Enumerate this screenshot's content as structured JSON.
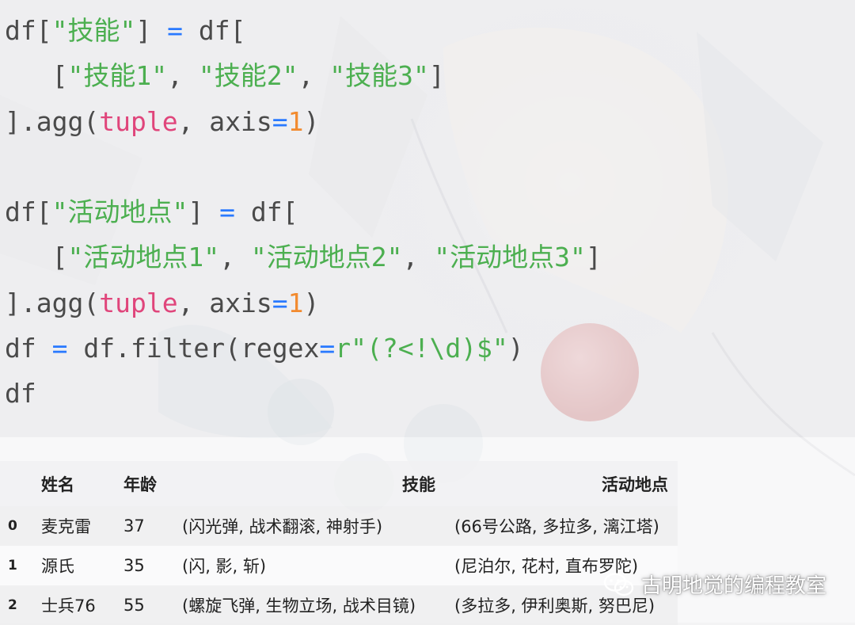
{
  "code": {
    "lines": [
      [
        {
          "t": "df[",
          "c": "plain"
        },
        {
          "t": "\"技能\"",
          "c": "str"
        },
        {
          "t": "] ",
          "c": "plain"
        },
        {
          "t": "=",
          "c": "op"
        },
        {
          "t": " df[",
          "c": "plain"
        }
      ],
      [
        {
          "t": "   [",
          "c": "plain"
        },
        {
          "t": "\"技能1\"",
          "c": "str"
        },
        {
          "t": ", ",
          "c": "plain"
        },
        {
          "t": "\"技能2\"",
          "c": "str"
        },
        {
          "t": ", ",
          "c": "plain"
        },
        {
          "t": "\"技能3\"",
          "c": "str"
        },
        {
          "t": "]",
          "c": "plain"
        }
      ],
      [
        {
          "t": "].agg(",
          "c": "plain"
        },
        {
          "t": "tuple",
          "c": "fn"
        },
        {
          "t": ", axis",
          "c": "plain"
        },
        {
          "t": "=",
          "c": "op"
        },
        {
          "t": "1",
          "c": "num"
        },
        {
          "t": ")",
          "c": "plain"
        }
      ],
      [],
      [
        {
          "t": "df[",
          "c": "plain"
        },
        {
          "t": "\"活动地点\"",
          "c": "str"
        },
        {
          "t": "] ",
          "c": "plain"
        },
        {
          "t": "=",
          "c": "op"
        },
        {
          "t": " df[",
          "c": "plain"
        }
      ],
      [
        {
          "t": "   [",
          "c": "plain"
        },
        {
          "t": "\"活动地点1\"",
          "c": "str"
        },
        {
          "t": ", ",
          "c": "plain"
        },
        {
          "t": "\"活动地点2\"",
          "c": "str"
        },
        {
          "t": ", ",
          "c": "plain"
        },
        {
          "t": "\"活动地点3\"",
          "c": "str"
        },
        {
          "t": "]",
          "c": "plain"
        }
      ],
      [
        {
          "t": "].agg(",
          "c": "plain"
        },
        {
          "t": "tuple",
          "c": "fn"
        },
        {
          "t": ", axis",
          "c": "plain"
        },
        {
          "t": "=",
          "c": "op"
        },
        {
          "t": "1",
          "c": "num"
        },
        {
          "t": ")",
          "c": "plain"
        }
      ],
      [
        {
          "t": "df ",
          "c": "plain"
        },
        {
          "t": "=",
          "c": "op"
        },
        {
          "t": " df.filter(regex",
          "c": "plain"
        },
        {
          "t": "=",
          "c": "op"
        },
        {
          "t": "r\"(?<!\\d)$\"",
          "c": "str"
        },
        {
          "t": ")",
          "c": "plain"
        }
      ],
      [
        {
          "t": "df",
          "c": "plain"
        }
      ]
    ]
  },
  "table": {
    "columns": [
      "姓名",
      "年龄",
      "技能",
      "活动地点"
    ],
    "rows": [
      {
        "index": "0",
        "name": "麦克雷",
        "age": "37",
        "skill": "(闪光弹, 战术翻滚, 神射手)",
        "place": "(66号公路, 多拉多, 漓江塔)"
      },
      {
        "index": "1",
        "name": "源氏",
        "age": "35",
        "skill": "(闪, 影, 斩)",
        "place": "(尼泊尔, 花村, 直布罗陀)"
      },
      {
        "index": "2",
        "name": "士兵76",
        "age": "55",
        "skill": "(螺旋飞弹, 生物立场, 战术目镜)",
        "place": "(多拉多, 伊利奥斯, 努巴尼)"
      }
    ]
  },
  "watermark": {
    "text": "古明地觉的编程教室",
    "icon": "wechat-icon"
  },
  "colors": {
    "string": "#4caf50",
    "operator": "#2979ff",
    "function": "#e0457b",
    "number": "#f28b30",
    "text": "#4a4a4a"
  }
}
